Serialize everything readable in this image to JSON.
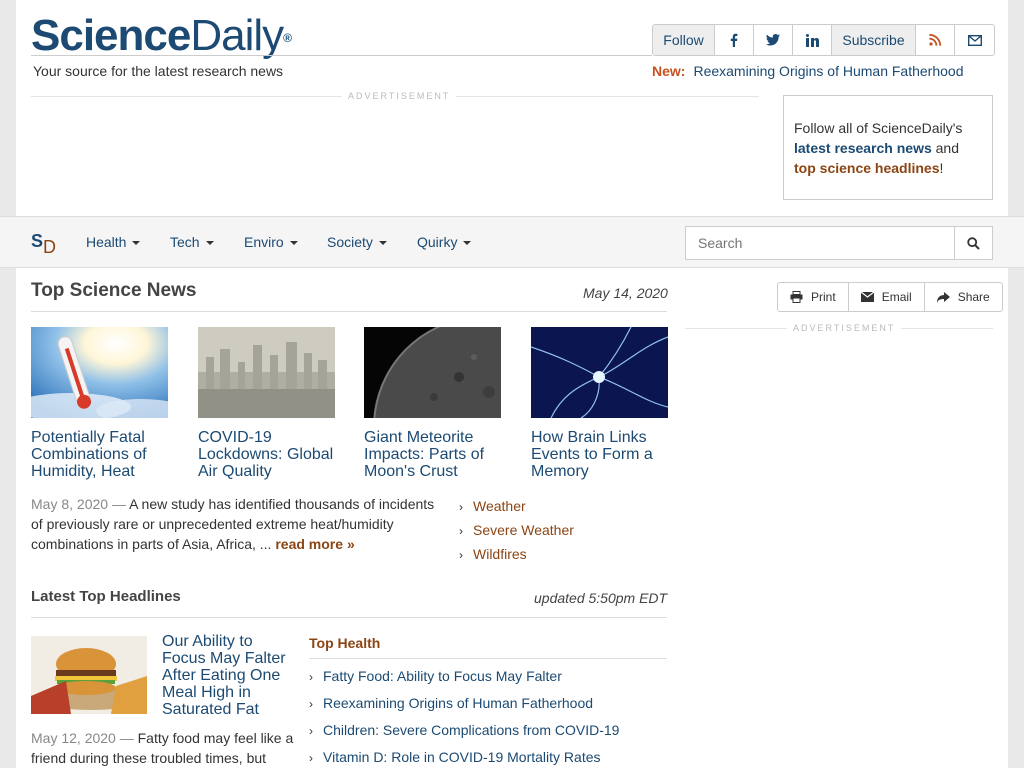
{
  "header": {
    "logo_part1": "Science",
    "logo_part2": "Daily",
    "logo_mark": "®",
    "tagline": "Your source for the latest research news",
    "follow_label": "Follow",
    "subscribe_label": "Subscribe",
    "new_label": "New:",
    "new_link": "Reexamining Origins of Human Fatherhood"
  },
  "ads": {
    "label": "ADVERTISEMENT"
  },
  "followbox": {
    "line1": "Follow all of ScienceDaily's",
    "link1": "latest research news",
    "and": " and",
    "link2": "top science headlines",
    "excl": "!"
  },
  "nav": {
    "logo_s": "S",
    "logo_d": "D",
    "items": [
      "Health",
      "Tech",
      "Enviro",
      "Society",
      "Quirky"
    ],
    "search_placeholder": "Search"
  },
  "top_news": {
    "title": "Top Science News",
    "date": "May 14, 2020",
    "stories": [
      {
        "title": "Potentially Fatal Combinations of Humidity, Heat"
      },
      {
        "title": "COVID-19 Lockdowns: Global Air Quality"
      },
      {
        "title": "Giant Meteorite Impacts: Parts of Moon's Crust"
      },
      {
        "title": "How Brain Links Events to Form a Memory"
      }
    ],
    "summary_date": "May 8, 2020",
    "summary_sep": " — ",
    "summary_text": "A new study has identified thousands of incidents of previously rare or unprecedented extreme heat/humidity combinations in parts of Asia, Africa, ... ",
    "read_more": "read more",
    "keywords": [
      "Weather",
      "Severe Weather",
      "Wildfires"
    ]
  },
  "tools": {
    "print": "Print",
    "email": "Email",
    "share": "Share"
  },
  "headlines": {
    "title": "Latest Top Headlines",
    "updated": "updated 5:50pm EDT",
    "feature_title": "Our Ability to Focus May Falter After Eating One Meal High in Saturated Fat",
    "feature_date": "May 12, 2020",
    "feature_sep": " — ",
    "feature_text": "Fatty food may feel like a friend during these troubled times, but",
    "top_health_label": "Top Health",
    "top_health": [
      "Fatty Food: Ability to Focus May Falter",
      "Reexamining Origins of Human Fatherhood",
      "Children: Severe Complications from COVID-19",
      "Vitamin D: Role in COVID-19 Mortality Rates"
    ]
  }
}
